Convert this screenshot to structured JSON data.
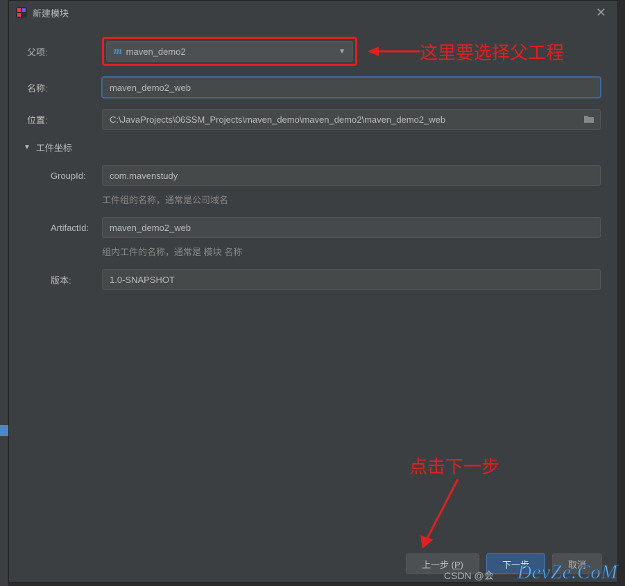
{
  "window": {
    "title": "新建模块"
  },
  "form": {
    "parent": {
      "label": "父项:",
      "value": "maven_demo2"
    },
    "name": {
      "label": "名称:",
      "value": "maven_demo2_web"
    },
    "location": {
      "label": "位置:",
      "value": "C:\\JavaProjects\\06SSM_Projects\\maven_demo\\maven_demo2\\maven_demo2_web"
    },
    "coords_section": "工件坐标",
    "group_id": {
      "label": "GroupId:",
      "value": "com.mavenstudy",
      "hint": "工件组的名称，通常是公司域名"
    },
    "artifact_id": {
      "label": "ArtifactId:",
      "value": "maven_demo2_web",
      "hint": "组内工件的名称，通常是 模块 名称"
    },
    "version": {
      "label": "版本:",
      "value": "1.0-SNAPSHOT"
    }
  },
  "buttons": {
    "prev": "上一步 (",
    "prev_mnemonic": "P",
    "prev_suffix": ")",
    "next": "下一步",
    "cancel": "取消"
  },
  "annotations": {
    "parent_hint": "这里要选择父工程",
    "next_hint": "点击下一步"
  },
  "watermark": "CSDN @会",
  "devze": "DevZe.CoM"
}
